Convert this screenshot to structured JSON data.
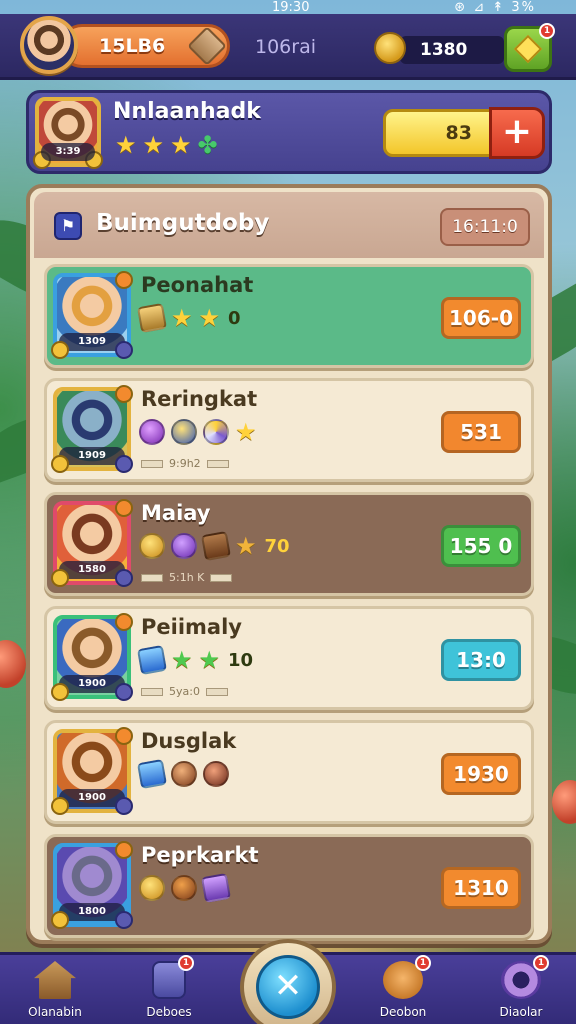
{
  "status_bar": {
    "time": "19:30",
    "icons": "⊛ ⊿ ↟ 3%"
  },
  "top_bar": {
    "currency_value": "15LB6",
    "mid_value": "106rai",
    "gold_value": "1380",
    "shop_badge": "1"
  },
  "player": {
    "name": "Nnlaanhadk",
    "level": "3:39",
    "energy_value": "83",
    "plus_label": "+"
  },
  "panel": {
    "title": "Buimgutdoby",
    "timer": "16:11:0"
  },
  "heroes": [
    {
      "name": "Peonahat",
      "level": "1309",
      "bonus": "0",
      "price": "106-0",
      "sub": "",
      "row_color": "#5bba88",
      "price_color": "#f28a2e",
      "name_color": "#2b3a20"
    },
    {
      "name": "Reringkat",
      "level": "1909",
      "bonus": "",
      "price": "531",
      "sub": "9:9h2",
      "row_color": "#f5ead4",
      "price_color": "#f2872e",
      "name_color": "#4a3a20"
    },
    {
      "name": "Maiay",
      "level": "1580",
      "bonus": "70",
      "price": "155 0",
      "sub": "5:1h K",
      "row_color": "#8a6a56",
      "price_color": "#4fbf4f",
      "name_color": "#ffffff"
    },
    {
      "name": "Peiimaly",
      "level": "1900",
      "bonus": "10",
      "price": "13:0",
      "sub": "5ya:0",
      "row_color": "#f5ead4",
      "price_color": "#3fc3d9",
      "name_color": "#4a3a20"
    },
    {
      "name": "Dusglak",
      "level": "1900",
      "bonus": "",
      "price": "1930",
      "sub": "",
      "row_color": "#f5ead4",
      "price_color": "#f28a2e",
      "name_color": "#4a3a20"
    },
    {
      "name": "Peprkarkt",
      "level": "1800",
      "bonus": "",
      "price": "1310",
      "sub": "",
      "row_color": "#8a6a56",
      "price_color": "#f28a2e",
      "name_color": "#ffffff"
    }
  ],
  "bottom_nav": [
    {
      "label": "Olanabin",
      "icon": "house-icon",
      "badge": ""
    },
    {
      "label": "Deboes",
      "icon": "card-deck-icon",
      "badge": "1"
    },
    {
      "label": "Deobon",
      "icon": "pet-icon",
      "badge": "1"
    },
    {
      "label": "Diaolar",
      "icon": "swirl-icon",
      "badge": "1"
    }
  ],
  "center_button": {
    "icon": "battle-icon",
    "glyph": "✕"
  }
}
